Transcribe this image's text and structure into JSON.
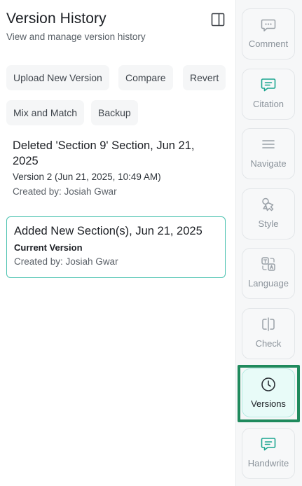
{
  "header": {
    "title": "Version History",
    "subtitle": "View and manage version history"
  },
  "actions": {
    "upload": "Upload New Version",
    "compare": "Compare",
    "revert": "Revert",
    "mix": "Mix and Match",
    "backup": "Backup"
  },
  "versions": [
    {
      "title": "Deleted 'Section 9' Section, Jun 21, 2025",
      "version": "Version 2 (Jun 21, 2025, 10:49 AM)",
      "created": "Created by: Josiah Gwar"
    },
    {
      "title": "Added New Section(s), Jun 21, 2025",
      "badge": "Current Version",
      "created": "Created by: Josiah Gwar"
    }
  ],
  "sidebar": {
    "items": [
      {
        "label": "Comment",
        "icon": "comment-icon"
      },
      {
        "label": "Citation",
        "icon": "citation-icon"
      },
      {
        "label": "Navigate",
        "icon": "menu-icon"
      },
      {
        "label": "Style",
        "icon": "style-icon"
      },
      {
        "label": "Language",
        "icon": "language-icon"
      },
      {
        "label": "Check",
        "icon": "check-icon"
      },
      {
        "label": "Versions",
        "icon": "clock-icon",
        "active": true
      },
      {
        "label": "Handwrite",
        "icon": "handwrite-icon"
      }
    ]
  },
  "colors": {
    "accent": "#1aa58f",
    "active_bg": "#e8fbf8",
    "highlight": "#1f8a5d",
    "current_border": "#4cc3b0"
  }
}
